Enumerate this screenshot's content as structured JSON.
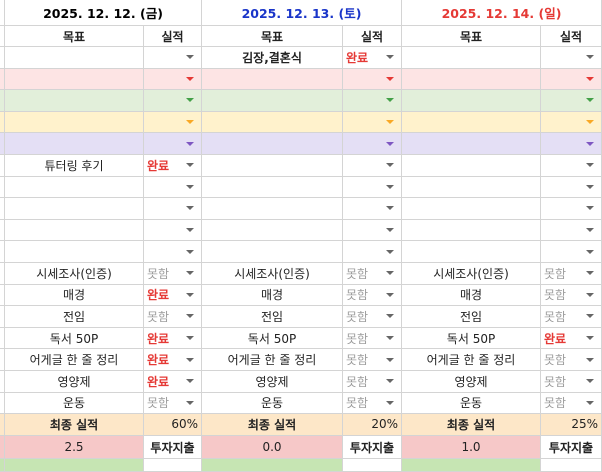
{
  "days": [
    {
      "date": "2025. 12. 12. (금)",
      "color": "#000000"
    },
    {
      "date": "2025. 12. 13. (토)",
      "color": "#1a35c9"
    },
    {
      "date": "2025. 12. 14. (일)",
      "color": "#e53935"
    }
  ],
  "col_headers": {
    "goal": "목표",
    "result": "실적"
  },
  "status": {
    "done": "완료",
    "fail": "못함"
  },
  "rows": [
    {
      "bg": "#ffffff",
      "cells": [
        [
          "",
          ""
        ],
        [
          "김장,결혼식",
          "done"
        ],
        [
          "",
          ""
        ]
      ]
    },
    {
      "bg": "#fde4e4",
      "cells": [
        [
          "",
          ""
        ],
        [
          "",
          ""
        ],
        [
          "",
          ""
        ]
      ]
    },
    {
      "bg": "#e2efda",
      "cells": [
        [
          "",
          ""
        ],
        [
          "",
          ""
        ],
        [
          "",
          ""
        ]
      ]
    },
    {
      "bg": "#fff2cc",
      "cells": [
        [
          "",
          ""
        ],
        [
          "",
          ""
        ],
        [
          "",
          ""
        ]
      ]
    },
    {
      "bg": "#e4dff5",
      "cells": [
        [
          "",
          ""
        ],
        [
          "",
          ""
        ],
        [
          "",
          ""
        ]
      ]
    },
    {
      "bg": "#ffffff",
      "cells": [
        [
          "튜터링 후기",
          "done"
        ],
        [
          "",
          ""
        ],
        [
          "",
          ""
        ]
      ]
    },
    {
      "bg": "#ffffff",
      "cells": [
        [
          "",
          ""
        ],
        [
          "",
          ""
        ],
        [
          "",
          ""
        ]
      ]
    },
    {
      "bg": "#ffffff",
      "cells": [
        [
          "",
          ""
        ],
        [
          "",
          ""
        ],
        [
          "",
          ""
        ]
      ]
    },
    {
      "bg": "#ffffff",
      "cells": [
        [
          "",
          ""
        ],
        [
          "",
          ""
        ],
        [
          "",
          ""
        ]
      ]
    },
    {
      "bg": "#ffffff",
      "cells": [
        [
          "",
          ""
        ],
        [
          "",
          ""
        ],
        [
          "",
          ""
        ]
      ]
    },
    {
      "bg": "#ffffff",
      "cells": [
        [
          "시세조사(인증)",
          "fail"
        ],
        [
          "시세조사(인증)",
          "fail"
        ],
        [
          "시세조사(인증)",
          "fail"
        ]
      ]
    },
    {
      "bg": "#ffffff",
      "cells": [
        [
          "매경",
          "done"
        ],
        [
          "매경",
          "fail"
        ],
        [
          "매경",
          "fail"
        ]
      ]
    },
    {
      "bg": "#ffffff",
      "cells": [
        [
          "전임",
          "fail"
        ],
        [
          "전임",
          "fail"
        ],
        [
          "전임",
          "fail"
        ]
      ]
    },
    {
      "bg": "#ffffff",
      "cells": [
        [
          "독서 50P",
          "done"
        ],
        [
          "독서 50P",
          "fail"
        ],
        [
          "독서 50P",
          "done"
        ]
      ]
    },
    {
      "bg": "#ffffff",
      "cells": [
        [
          "어게글 한 줄 정리",
          "done"
        ],
        [
          "어게글 한 줄 정리",
          "fail"
        ],
        [
          "어게글 한 줄 정리",
          "fail"
        ]
      ]
    },
    {
      "bg": "#ffffff",
      "cells": [
        [
          "영양제",
          "done"
        ],
        [
          "영양제",
          "fail"
        ],
        [
          "영양제",
          "fail"
        ]
      ]
    },
    {
      "bg": "#ffffff",
      "cells": [
        [
          "운동",
          "fail"
        ],
        [
          "운동",
          "fail"
        ],
        [
          "운동",
          "fail"
        ]
      ]
    }
  ],
  "final": {
    "label": "최종 실적",
    "values": [
      "60%",
      "20%",
      "25%"
    ]
  },
  "invest": {
    "label": "투자지출",
    "values": [
      "2.5",
      "0.0",
      "1.0"
    ]
  }
}
